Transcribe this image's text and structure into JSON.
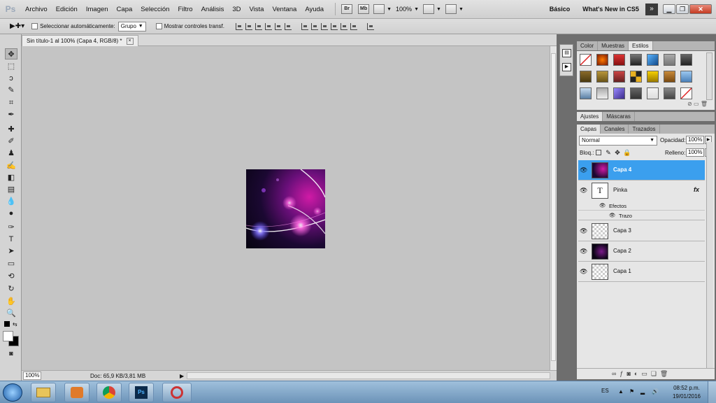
{
  "app": {
    "logo": "Ps"
  },
  "menu": [
    "Archivo",
    "Edición",
    "Imagen",
    "Capa",
    "Selección",
    "Filtro",
    "Análisis",
    "3D",
    "Vista",
    "Ventana",
    "Ayuda"
  ],
  "menubar": {
    "bridge": "Br",
    "minibridge": "Mb",
    "zoom": "100%",
    "workspace": "Básico",
    "whats_new": "What's New in CS5"
  },
  "options": {
    "auto_select": "Seleccionar automáticamente:",
    "auto_select_mode": "Grupo",
    "show_transform": "Mostrar controles transf."
  },
  "document": {
    "tab_title": "Sin título-1 al 100% (Capa 4, RGB/8) *",
    "close": "×"
  },
  "status": {
    "zoom": "100%",
    "doc": "Doc: 65,9 KB/3,81 MB"
  },
  "styles_panel": {
    "tabs": [
      "Color",
      "Muestras",
      "Estilos"
    ]
  },
  "adjust_panel": {
    "tabs": [
      "Ajustes",
      "Máscaras"
    ]
  },
  "layers_panel": {
    "tabs": [
      "Capas",
      "Canales",
      "Trazados"
    ],
    "blend_mode": "Normal",
    "opacity_label": "Opacidad:",
    "opacity": "100%",
    "lock_label": "Bloq.:",
    "fill_label": "Relleno:",
    "fill": "100%",
    "layers": [
      {
        "name": "Capa 4"
      },
      {
        "name": "Pinka",
        "type_glyph": "T",
        "fx": "fx"
      },
      {
        "name": "Capa 3"
      },
      {
        "name": "Capa 2"
      },
      {
        "name": "Capa 1"
      }
    ],
    "effects_label": "Efectos",
    "stroke_label": "Trazo"
  },
  "taskbar": {
    "ps_label": "Ps",
    "lang": "ES",
    "time": "08:52 p.m.",
    "date": "19/01/2016"
  },
  "colors": {
    "selected_layer": "#3b9fee",
    "panel_dark": "#6e6e6e",
    "canvas": "#c4c4c4"
  }
}
